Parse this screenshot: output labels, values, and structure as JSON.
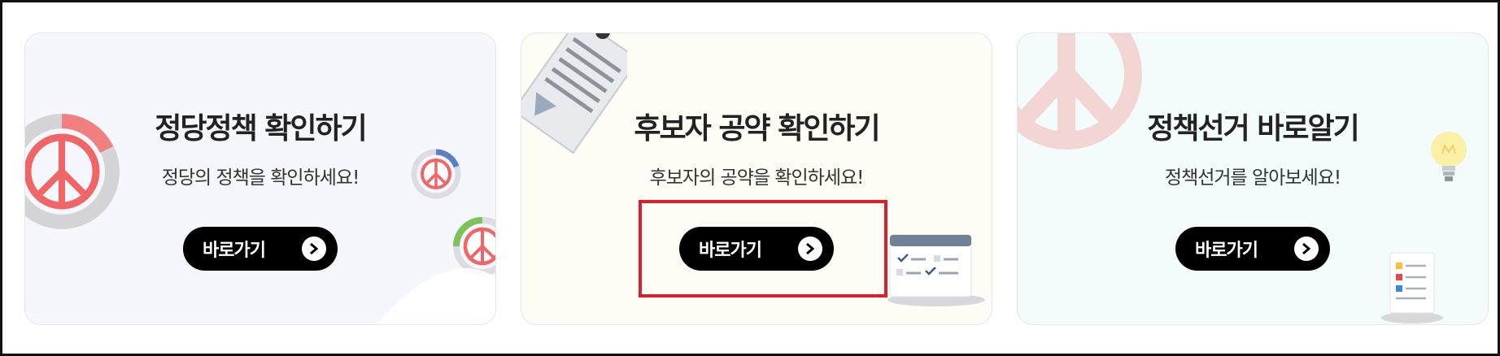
{
  "cards": [
    {
      "title": "정당정책 확인하기",
      "subtitle": "정당의 정책을 확인하세요!",
      "button_label": "바로가기",
      "background": "#f6f6fd"
    },
    {
      "title": "후보자 공약 확인하기",
      "subtitle": "후보자의 공약을 확인하세요!",
      "button_label": "바로가기",
      "background": "#fdfdf6"
    },
    {
      "title": "정책선거 바로알기",
      "subtitle": "정책선거를 알아보세요!",
      "button_label": "바로가기",
      "background": "#f3fbfb"
    }
  ],
  "icons": {
    "button_arrow": "chevron-right-circle-icon",
    "vote_stamp": "vote-stamp-icon",
    "document": "document-icon",
    "checklist": "checklist-icon",
    "lightbulb": "lightbulb-icon"
  },
  "colors": {
    "highlight_border": "#d9202c",
    "stamp_red": "#f06666",
    "button_bg": "#000000"
  }
}
